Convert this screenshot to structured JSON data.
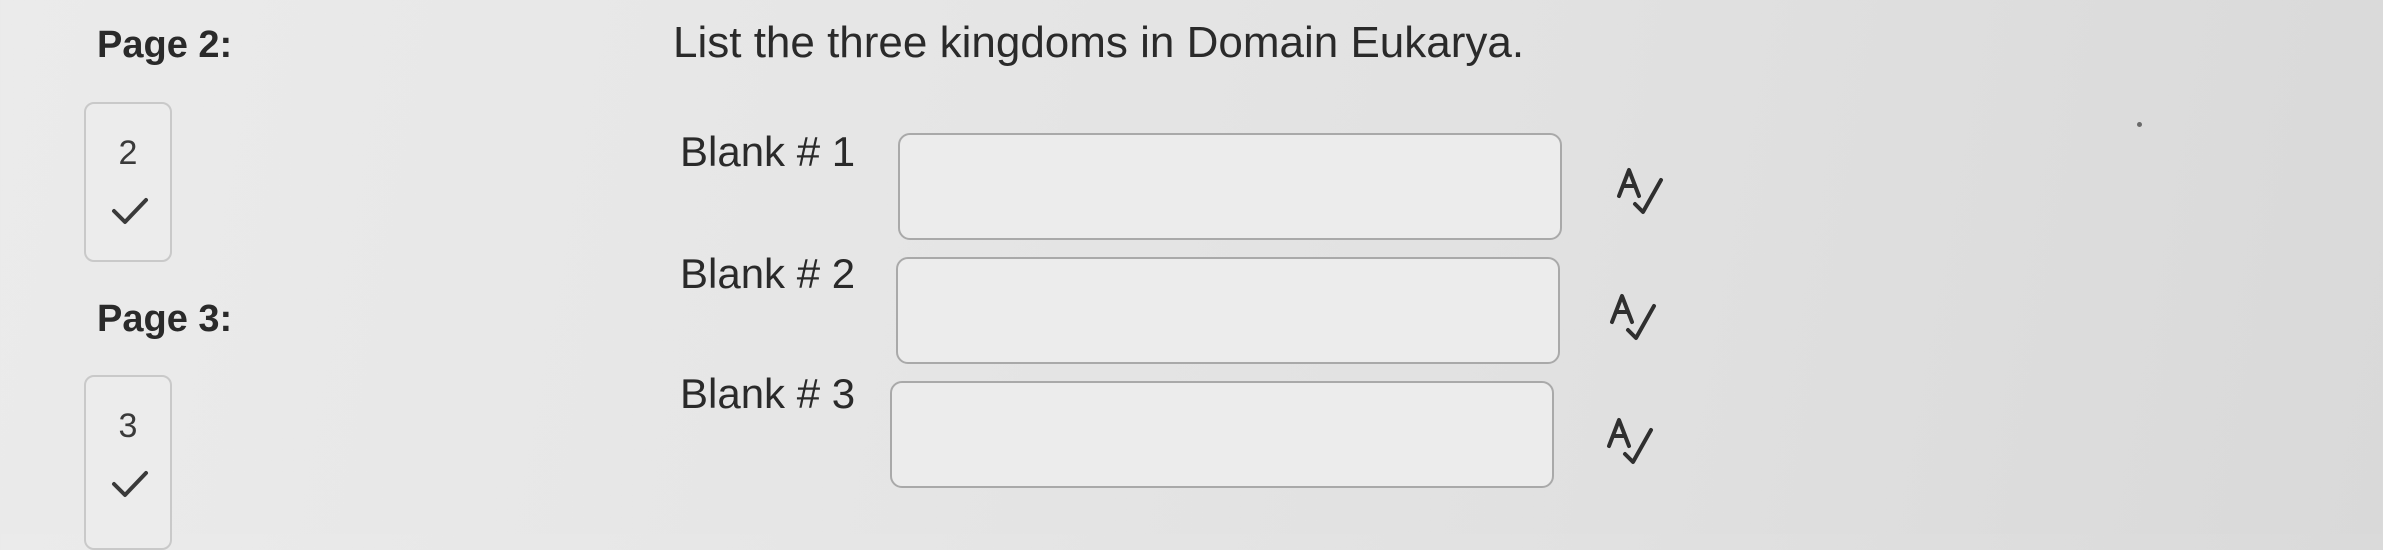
{
  "nav": {
    "page2": {
      "label": "Page 2:",
      "number": "2",
      "status_icon": "checkmark-icon"
    },
    "page3": {
      "label": "Page 3:",
      "number": "3",
      "status_icon": "checkmark-icon"
    }
  },
  "question": {
    "text": "List the three kingdoms in Domain Eukarya."
  },
  "blanks": [
    {
      "label": "Blank # 1",
      "value": "",
      "placeholder": "",
      "tool_icon": "spellcheck-icon"
    },
    {
      "label": "Blank # 2",
      "value": "",
      "placeholder": "",
      "tool_icon": "spellcheck-icon"
    },
    {
      "label": "Blank # 3",
      "value": "",
      "placeholder": "",
      "tool_icon": "spellcheck-icon"
    }
  ],
  "colors": {
    "background": "#e4e4e4",
    "text": "#2a2a2a",
    "input_border": "#a9a9a9"
  }
}
